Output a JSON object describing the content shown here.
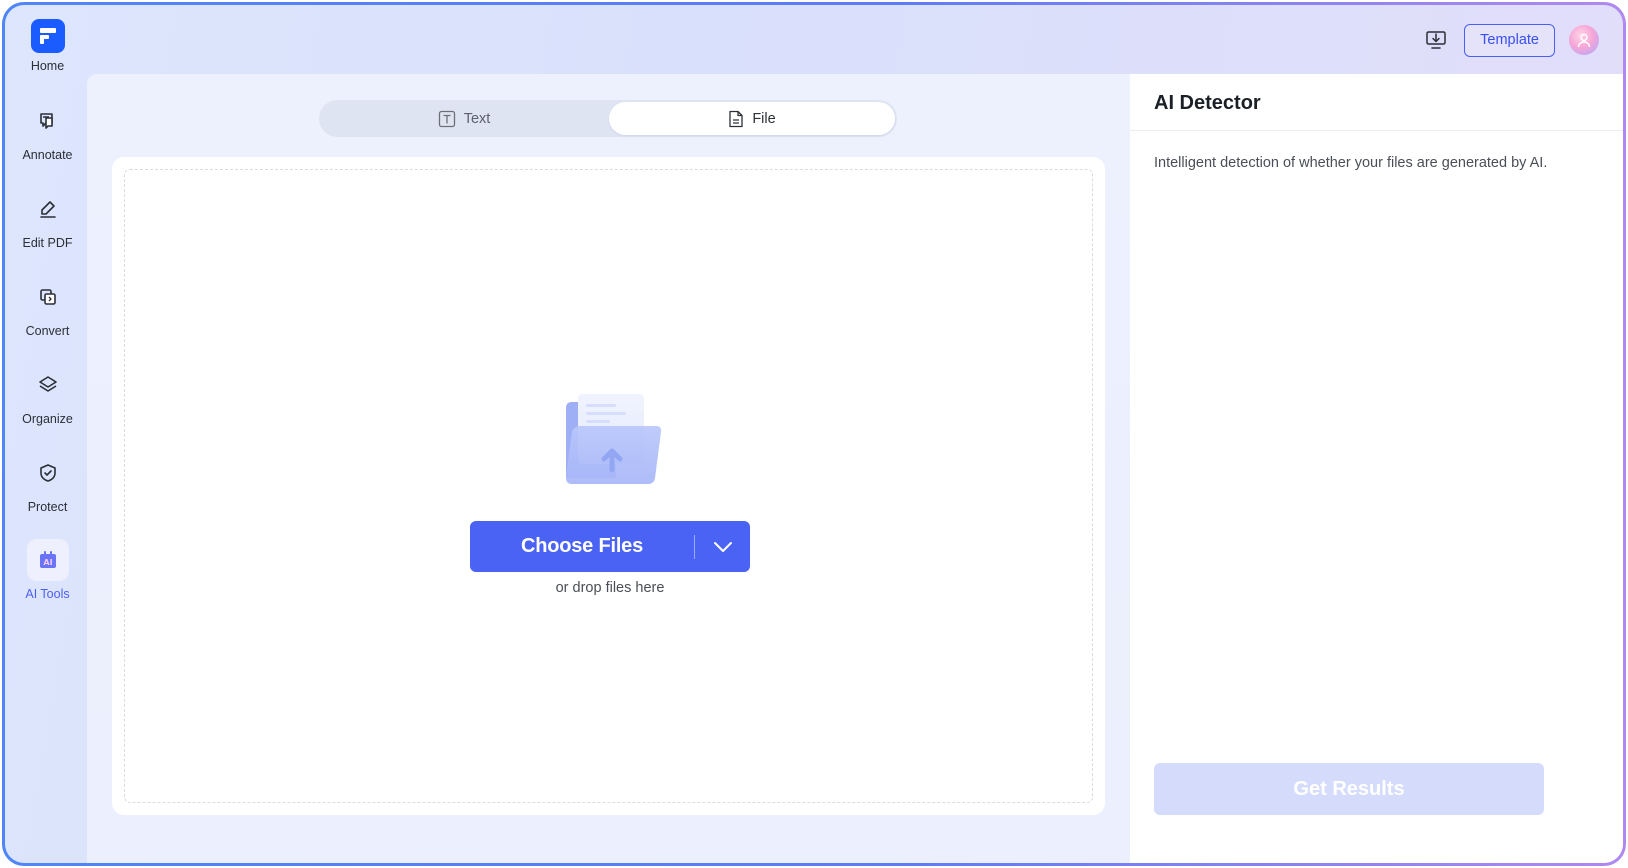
{
  "sidebar": {
    "home_label": "Home",
    "items": [
      {
        "label": "Annotate",
        "icon": "annotate-icon"
      },
      {
        "label": "Edit PDF",
        "icon": "edit-pen-icon"
      },
      {
        "label": "Convert",
        "icon": "convert-icon"
      },
      {
        "label": "Organize",
        "icon": "layers-icon"
      },
      {
        "label": "Protect",
        "icon": "shield-icon"
      },
      {
        "label": "AI Tools",
        "icon": "ai-tools-icon",
        "active": true
      }
    ]
  },
  "topbar": {
    "template_label": "Template"
  },
  "main": {
    "tabs": [
      {
        "label": "Text",
        "icon": "text-box-icon",
        "selected": false
      },
      {
        "label": "File",
        "icon": "document-icon",
        "selected": true
      }
    ],
    "choose_files_label": "Choose Files",
    "drop_hint": "or drop files here"
  },
  "panel": {
    "title": "AI Detector",
    "description": "Intelligent detection of whether your files are generated by AI.",
    "get_results_label": "Get Results"
  },
  "colors": {
    "accent": "#4a63f4",
    "brand": "#1a5cff",
    "disabled_button": "#d5dcfb",
    "active_nav": "#4b5ff5"
  }
}
